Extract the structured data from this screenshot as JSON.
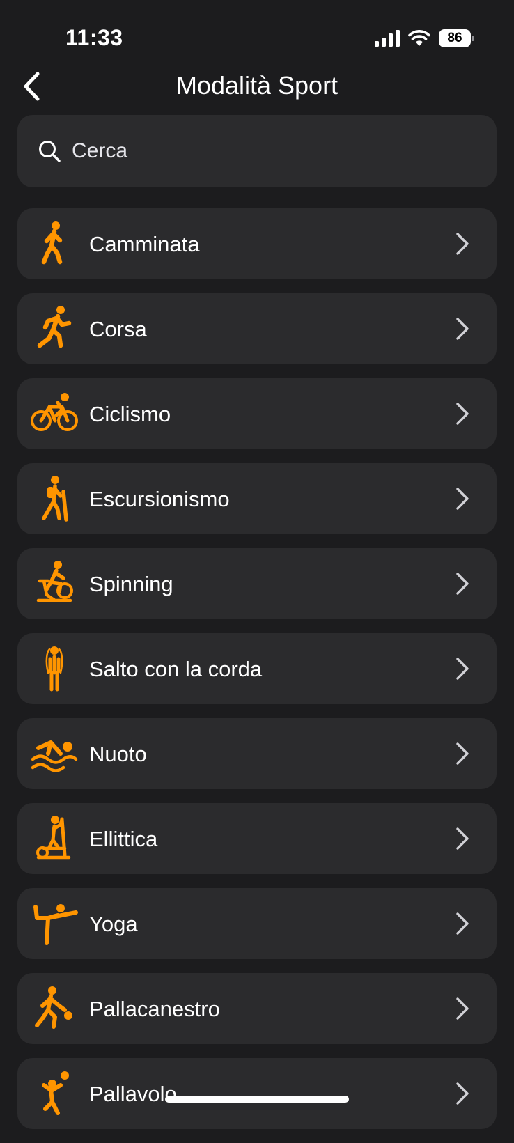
{
  "status_bar": {
    "time": "11:33",
    "battery_level": "86"
  },
  "header": {
    "title": "Modalità Sport",
    "back_icon": "chevron-left-icon"
  },
  "search": {
    "placeholder": "Cerca",
    "value": "",
    "icon": "search-icon"
  },
  "colors": {
    "accent": "#ff9500",
    "background": "#1c1c1e",
    "card": "#2b2b2d"
  },
  "sports": [
    {
      "label": "Camminata",
      "icon": "walking-icon"
    },
    {
      "label": "Corsa",
      "icon": "running-icon"
    },
    {
      "label": "Ciclismo",
      "icon": "cycling-icon"
    },
    {
      "label": "Escursionismo",
      "icon": "hiking-icon"
    },
    {
      "label": "Spinning",
      "icon": "spinning-icon"
    },
    {
      "label": "Salto con la corda",
      "icon": "jump-rope-icon"
    },
    {
      "label": "Nuoto",
      "icon": "swimming-icon"
    },
    {
      "label": "Ellittica",
      "icon": "elliptical-icon"
    },
    {
      "label": "Yoga",
      "icon": "yoga-icon"
    },
    {
      "label": "Pallacanestro",
      "icon": "basketball-icon"
    },
    {
      "label": "Pallavolo",
      "icon": "volleyball-icon"
    }
  ]
}
